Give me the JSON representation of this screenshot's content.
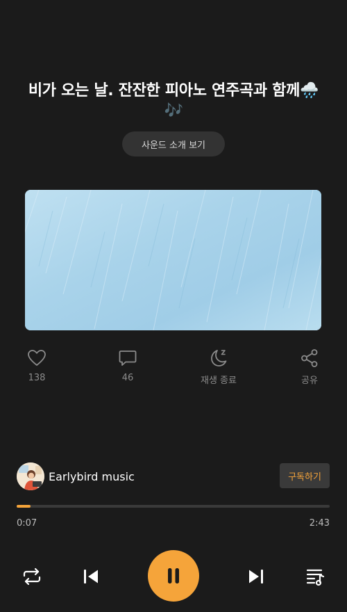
{
  "title": "비가 오는 날. 잔잔한 피아노 연주곡과 함께🌧️🎶",
  "intro_button": "사운드 소개 보기",
  "actions": {
    "like": {
      "label": "138",
      "icon": "heart-icon"
    },
    "comment": {
      "label": "46",
      "icon": "comment-icon"
    },
    "sleep_timer": {
      "label": "재생 종료",
      "icon": "moon-icon"
    },
    "share": {
      "label": "공유",
      "icon": "share-icon"
    }
  },
  "channel": {
    "name": "Earlybird music",
    "avatar": "channel-avatar"
  },
  "subscribe_label": "구독하기",
  "player": {
    "current_time": "0:07",
    "total_time": "2:43",
    "progress": 0.045
  },
  "controls": {
    "repeat": "repeat-icon",
    "previous": "skip-previous-icon",
    "play_pause": "pause-icon",
    "next": "skip-next-icon",
    "playlist": "playlist-icon"
  },
  "colors": {
    "background": "#1b1b1b",
    "accent": "#f5a43a",
    "muted_text": "#8c8c8c",
    "cover_blue": "#a6d2ea"
  }
}
